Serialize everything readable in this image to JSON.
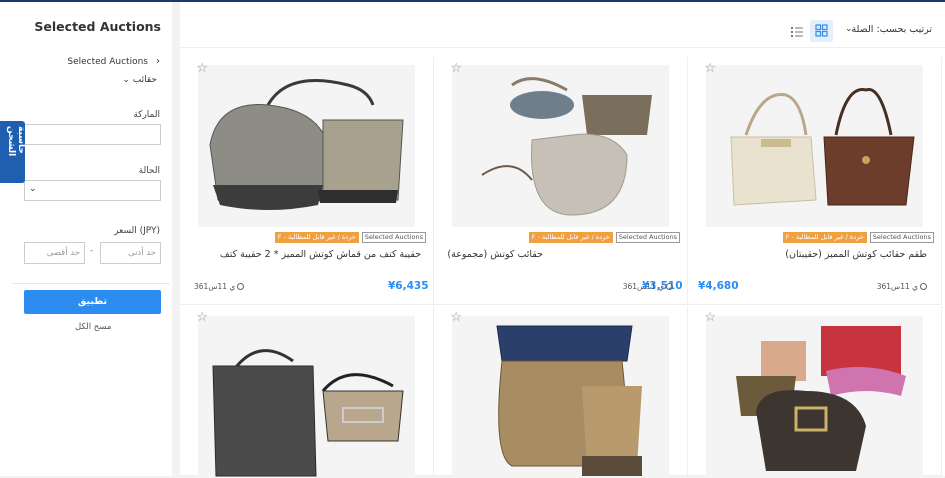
{
  "sidebar": {
    "title": "Selected Auctions",
    "crumb": "Selected Auctions",
    "category": "حقائب",
    "brand_label": "الماركة",
    "condition_label": "الحالة",
    "price_label": "السعر (JPY)",
    "price_max_placeholder": "حد أقصى",
    "price_min_placeholder": "حد أدنى",
    "price_dash": "-",
    "apply": "تطبيق",
    "clear": "مسح الكل",
    "side_tab": "حاسبة الشحن"
  },
  "toolbar": {
    "sort_text": "ترتيب بحسب: الصلة"
  },
  "products": [
    {
      "title": "طقم حقائب كوتش المميز (حقيبتان)",
      "price": "¥4,680",
      "time": "361ي 11س",
      "tag1": "Selected Auctions",
      "tag2": "F - خردة / غير قابل للمطالبة"
    },
    {
      "title": "حقائب كوتش (مجموعة)",
      "price": "¥3,510",
      "time": "361ي 11س",
      "tag1": "Selected Auctions",
      "tag2": "F - خردة / غير قابل للمطالبة"
    },
    {
      "title": "حقيبة كتف من قماش كوتش المميز * 2 حقيبة كتف",
      "price": "¥6,435",
      "time": "361ي 11س",
      "tag1": "Selected Auctions",
      "tag2": "F - خردة / غير قابل للمطالبة"
    }
  ],
  "colors": {
    "accent": "#2d8cf0",
    "side_tab": "#1e5fb0",
    "rank_tag": "#f0a040"
  }
}
